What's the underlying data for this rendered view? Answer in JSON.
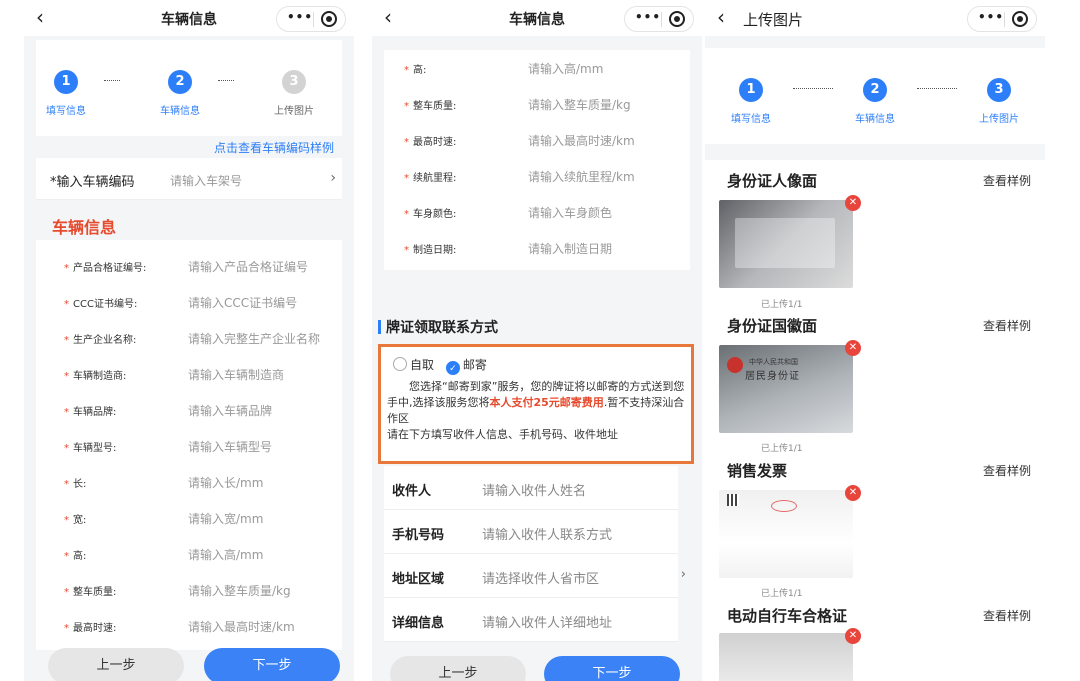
{
  "colors": {
    "accent": "#2d7ff9",
    "required_star": "#e64b2e",
    "highlight_border": "#e8783a",
    "delete_badge": "#e8453c"
  },
  "icons": {
    "back": "chevron-left-icon",
    "more": "more-dots-icon",
    "close_mini": "target-circle-icon",
    "arrow": "chevron-right-icon",
    "delete": "delete-icon"
  },
  "nav": {
    "more_dots": "•••"
  },
  "steps": [
    "填写信息",
    "车辆信息",
    "上传图片"
  ],
  "step_numbers": [
    "1",
    "2",
    "3"
  ],
  "screen1": {
    "title": "车辆信息",
    "sample_link": "点击查看车辆编码样例",
    "code_label": "*输入车辆编码",
    "code_placeholder": "请输入车架号",
    "section_title": "车辆信息",
    "fields": [
      {
        "label": "产品合格证编号:",
        "placeholder": "请输入产品合格证编号"
      },
      {
        "label": "CCC证书编号:",
        "placeholder": "请输入CCC证书编号"
      },
      {
        "label": "生产企业名称:",
        "placeholder": "请输入完整生产企业名称"
      },
      {
        "label": "车辆制造商:",
        "placeholder": "请输入车辆制造商"
      },
      {
        "label": "车辆品牌:",
        "placeholder": "请输入车辆品牌"
      },
      {
        "label": "车辆型号:",
        "placeholder": "请输入车辆型号"
      },
      {
        "label": "长:",
        "placeholder": "请输入长/mm"
      },
      {
        "label": "宽:",
        "placeholder": "请输入宽/mm"
      },
      {
        "label": "高:",
        "placeholder": "请输入高/mm"
      },
      {
        "label": "整车质量:",
        "placeholder": "请输入整车质量/kg"
      },
      {
        "label": "最高时速:",
        "placeholder": "请输入最高时速/km"
      }
    ],
    "prev": "上一步",
    "next": "下一步"
  },
  "screen2": {
    "title": "车辆信息",
    "fields": [
      {
        "label": "高:",
        "placeholder": "请输入高/mm"
      },
      {
        "label": "整车质量:",
        "placeholder": "请输入整车质量/kg"
      },
      {
        "label": "最高时速:",
        "placeholder": "请输入最高时速/km"
      },
      {
        "label": "续航里程:",
        "placeholder": "请输入续航里程/km"
      },
      {
        "label": "车身颜色:",
        "placeholder": "请输入车身颜色"
      },
      {
        "label": "制造日期:",
        "placeholder": "请输入制造日期"
      }
    ],
    "pickup_title": "牌证领取联系方式",
    "option_self": "自取",
    "option_mail": "邮寄",
    "notice_part1": "您选择“邮寄到家”服务，您的牌证将以邮寄的方式送到您手中,选择该服务您将",
    "notice_highlight": "本人支付25元邮寄费用",
    "notice_part2": ".暂不支持深汕合作区",
    "notice_line2": "请在下方填写收件人信息、手机号码、收件地址",
    "contact": [
      {
        "label": "收件人",
        "placeholder": "请输入收件人姓名",
        "arrow": false
      },
      {
        "label": "手机号码",
        "placeholder": "请输入收件人联系方式",
        "arrow": false
      },
      {
        "label": "地址区域",
        "placeholder": "请选择收件人省市区",
        "arrow": true
      },
      {
        "label": "详细信息",
        "placeholder": "请输入收件人详细地址",
        "arrow": false
      }
    ],
    "prev": "上一步",
    "next": "下一步"
  },
  "screen3": {
    "title": "上传图片",
    "docs": [
      {
        "title": "身份证人像面",
        "sample": "查看样例",
        "uploaded": "已上传1/1"
      },
      {
        "title": "身份证国徽面",
        "sample": "查看样例",
        "uploaded": "已上传1/1",
        "card_header": "中华人民共和国",
        "card_sub": "居民身份证"
      },
      {
        "title": "销售发票",
        "sample": "查看样例",
        "uploaded": "已上传1/1"
      },
      {
        "title": "电动自行车合格证",
        "sample": "查看样例"
      }
    ]
  }
}
